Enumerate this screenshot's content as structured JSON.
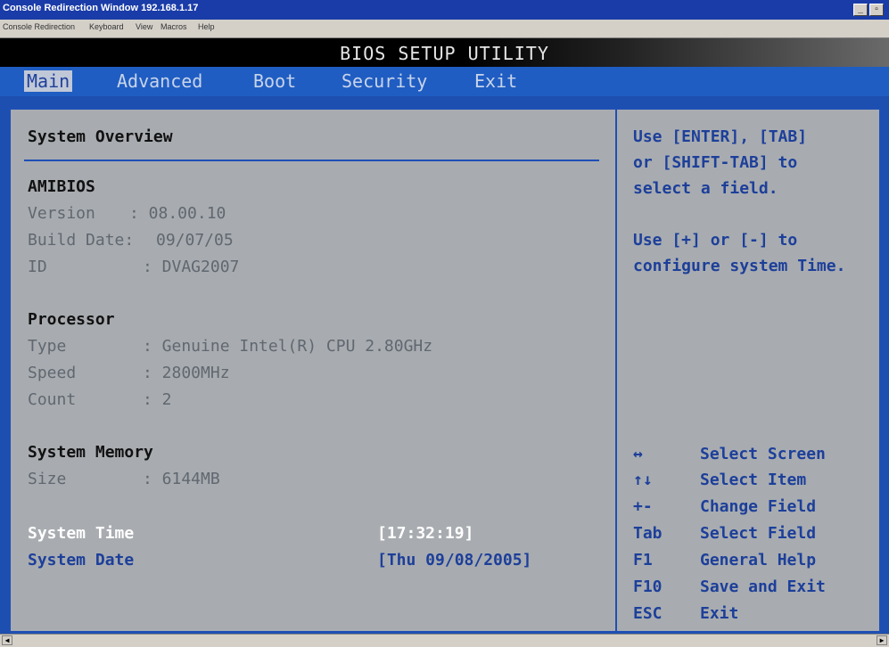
{
  "window": {
    "title": "Console Redirection Window  192.168.1.17",
    "menu": [
      "Console Redirection",
      "Keyboard",
      "View",
      "Macros",
      "Help"
    ],
    "buttons": [
      "_",
      "▫"
    ]
  },
  "bios": {
    "title": "BIOS SETUP UTILITY",
    "tabs": [
      "Main",
      "Advanced",
      "Boot",
      "Security",
      "Exit"
    ],
    "active_tab": "Main"
  },
  "overview": {
    "heading": "System Overview",
    "amibios": {
      "heading": "AMIBIOS",
      "version_label": "Version",
      "version_value": ": 08.00.10",
      "build_label": "Build Date:",
      "build_value": "09/07/05",
      "id_label": "ID",
      "id_value": ": DVAG2007"
    },
    "processor": {
      "heading": "Processor",
      "type_label": "Type",
      "type_value": ": Genuine Intel(R) CPU 2.80GHz",
      "speed_label": "Speed",
      "speed_value": ": 2800MHz",
      "count_label": "Count",
      "count_value": ": 2"
    },
    "memory": {
      "heading": "System Memory",
      "size_label": "Size",
      "size_value": ": 6144MB"
    },
    "time_label": "System Time",
    "time_value": "[17:32:19]",
    "date_label": "System Date",
    "date_value": "[Thu 09/08/2005]"
  },
  "help": {
    "lines": [
      "Use [ENTER], [TAB]",
      "or [SHIFT-TAB] to",
      "select a field.",
      "",
      "Use [+] or [-] to",
      "configure system Time."
    ],
    "keys": [
      {
        "key": "↔",
        "action": "Select Screen"
      },
      {
        "key": "↑↓",
        "action": "Select Item"
      },
      {
        "key": "+-",
        "action": "Change Field"
      },
      {
        "key": "Tab",
        "action": "Select Field"
      },
      {
        "key": "F1",
        "action": "General Help"
      },
      {
        "key": "F10",
        "action": "Save and Exit"
      },
      {
        "key": "ESC",
        "action": "Exit"
      }
    ]
  },
  "colors": {
    "title_bar": "#1a3ca8",
    "tab_bar": "#1f5dc2",
    "panel": "#a8acb0",
    "highlight_text": "#1d3f9a"
  }
}
